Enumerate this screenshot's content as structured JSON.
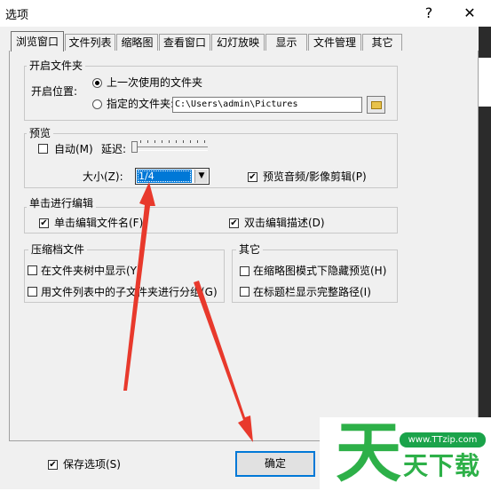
{
  "window": {
    "title": "选项",
    "help_btn": "?",
    "close_btn": "✕"
  },
  "tabs": [
    {
      "label": "浏览窗口",
      "active": true
    },
    {
      "label": "文件列表",
      "active": false
    },
    {
      "label": "缩略图",
      "active": false
    },
    {
      "label": "查看窗口",
      "active": false
    },
    {
      "label": "幻灯放映",
      "active": false
    },
    {
      "label": "显示",
      "active": false
    },
    {
      "label": "文件管理",
      "active": false
    },
    {
      "label": "其它",
      "active": false
    }
  ],
  "startup": {
    "group_title": "开启文件夹",
    "position_label": "开启位置:",
    "radio_last": "上一次使用的文件夹",
    "radio_specified": "指定的文件夹:",
    "path_value": "C:\\Users\\admin\\Pictures",
    "selected": "last"
  },
  "preview": {
    "group_title": "预览",
    "auto_label": "自动(M)",
    "auto_checked": false,
    "delay_label": "延迟:",
    "delay_level": 0,
    "size_label": "大小(Z):",
    "size_value": "1/4",
    "av_label": "预览音频/影像剪辑(P)",
    "av_checked": true
  },
  "edit": {
    "group_title": "单击进行编辑",
    "filename_label": "单击编辑文件名(F)",
    "filename_checked": true,
    "desc_label": "双击编辑描述(D)",
    "desc_checked": true
  },
  "archive": {
    "group_title": "压缩档文件",
    "tree_label": "在文件夹树中显示(Y)",
    "tree_checked": false,
    "group_label": "用文件列表中的子文件夹进行分组(G)",
    "group_checked": false
  },
  "other": {
    "group_title": "其它",
    "hide_preview_label": "在缩略图模式下隐藏预览(H)",
    "hide_preview_checked": false,
    "fullpath_label": "在标题栏显示完整路径(I)",
    "fullpath_checked": false
  },
  "footer": {
    "save_label": "保存选项(S)",
    "save_checked": true,
    "ok_label": "确定"
  },
  "watermark": {
    "url": "www.TTzip.com",
    "logo_char": "天",
    "text": "天下载"
  },
  "colors": {
    "accent": "#0078d7",
    "annotation_arrow": "#e8392c",
    "watermark_green": "#2db048"
  }
}
